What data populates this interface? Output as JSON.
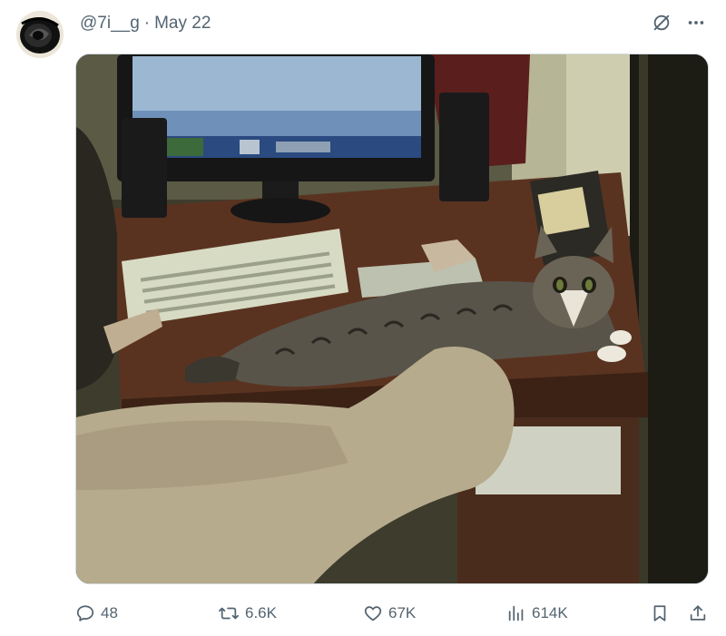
{
  "author": {
    "handle": "@7i__g",
    "separator": "·",
    "date": "May 22"
  },
  "header_icons": [
    "grok-icon",
    "more-icon"
  ],
  "media": {
    "description_icon": "photo"
  },
  "actions": {
    "reply": {
      "icon": "reply-icon",
      "count": "48"
    },
    "retweet": {
      "icon": "retweet-icon",
      "count": "6.6K"
    },
    "like": {
      "icon": "heart-icon",
      "count": "67K"
    },
    "views": {
      "icon": "views-icon",
      "count": "614K"
    },
    "bookmark": {
      "icon": "bookmark-icon"
    },
    "share": {
      "icon": "share-icon"
    }
  },
  "colors": {
    "muted_text": "#536471",
    "border": "#cfd9de",
    "background": "#ffffff"
  }
}
